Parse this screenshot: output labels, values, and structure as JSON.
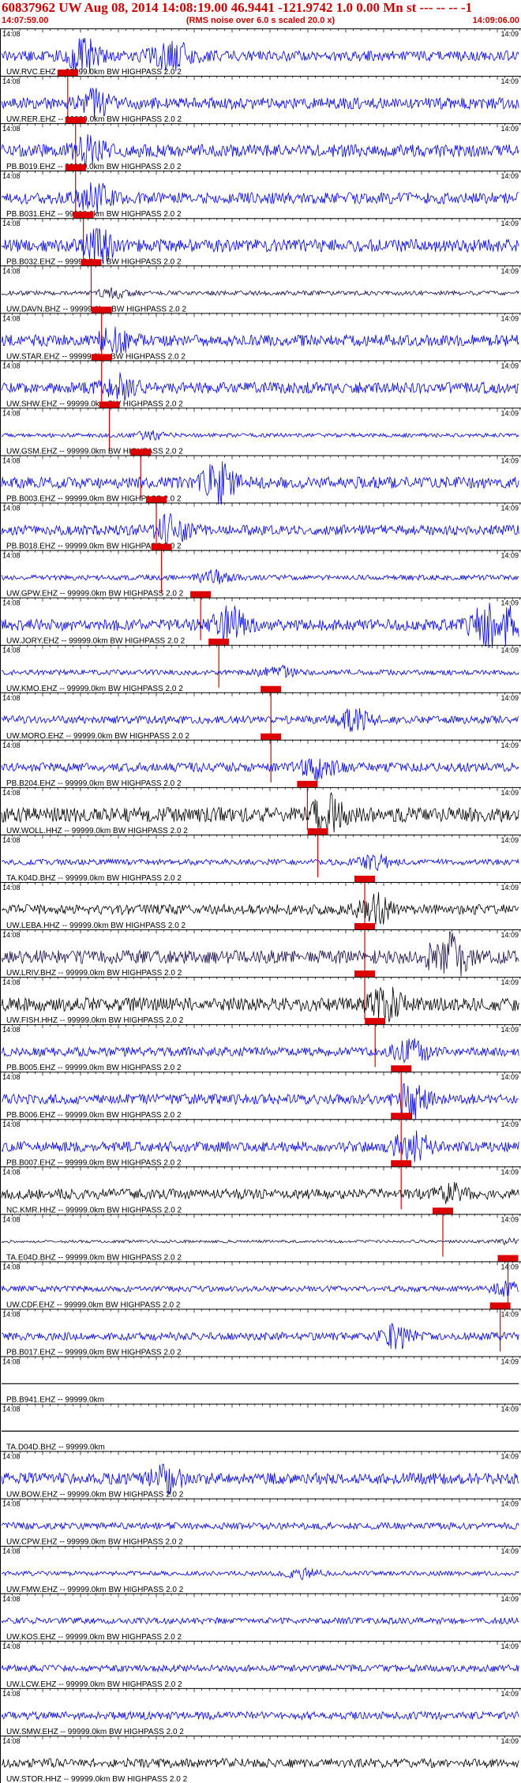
{
  "header": {
    "title": "60837962 UW Aug 08, 2014 14:08:19.00   46.9441 -121.9742  1.0 0.00 Mn st --- -- --  -1",
    "start_time": "14:07:59.00",
    "rms_note": "(RMS noise over 6.0 s scaled 20.0 x)",
    "end_time": "14:09:06.00"
  },
  "colors": {
    "trace_blue": "#0000ee",
    "trace_black": "#000000",
    "trace_navy": "#1a0a4a",
    "pick_red": "#dd0000",
    "label_red": "#cc0000"
  },
  "chart_data": {
    "type": "line",
    "title": "60837962 UW Aug 08, 2014 14:08:19.00",
    "x_start_label": "14:08",
    "x_end_label": "14:09",
    "x_range_seconds": [
      0,
      67
    ],
    "traces": [
      {
        "label": "UW.RVC.EHZ -- 99999.0km BW  HIGHPASS  2.0  2",
        "color": "blue",
        "amp": 0.9,
        "pick": 0.13,
        "burst": 0.16,
        "burst_amp": 2.0,
        "burst2": 0.33,
        "burst2_amp": 1.6
      },
      {
        "label": "UW.RER.EHZ -- 99999.0km BW  HIGHPASS  2.0  2",
        "color": "blue",
        "amp": 1.0,
        "pick": 0.145,
        "burst": 0.18,
        "burst_amp": 1.3
      },
      {
        "label": "PB.B019.EHZ -- 99999.0km BW  HIGHPASS  2.0  2",
        "color": "blue",
        "amp": 1.1,
        "pick": 0.145,
        "burst": 0.17,
        "burst_amp": 1.2
      },
      {
        "label": "PB.B031.EHZ -- 99999.0km BW  HIGHPASS  2.0  2",
        "color": "blue",
        "amp": 1.0,
        "pick": 0.16,
        "burst": 0.18,
        "burst_amp": 1.6
      },
      {
        "label": "PB.B032.EHZ -- 99999.0km BW  HIGHPASS  2.0  2",
        "color": "blue",
        "amp": 1.1,
        "pick": 0.175,
        "burst": 0.19,
        "burst_amp": 1.4
      },
      {
        "label": "UW.DAVN.BHZ -- 99999.0km BW  HIGHPASS  2.0  2",
        "color": "navy",
        "amp": 0.4,
        "pick": 0.195,
        "burst": 0.22,
        "burst_amp": 1.3
      },
      {
        "label": "UW.STAR.EHZ -- 99999.0km BW  HIGHPASS  2.0  2",
        "color": "blue",
        "amp": 1.0,
        "pick": 0.195,
        "burst": 0.22,
        "burst_amp": 1.4
      },
      {
        "label": "UW.SHW.EHZ -- 99999.0km BW  HIGHPASS  2.0  2",
        "color": "blue",
        "amp": 1.0,
        "pick": 0.21,
        "burst": 0.23,
        "burst_amp": 1.2
      },
      {
        "label": "UW.GSM.EHZ -- 99999.0km BW  HIGHPASS  2.0  2",
        "color": "blue",
        "amp": 0.35,
        "pick": 0.27,
        "burst": 0.29,
        "burst_amp": 1.2
      },
      {
        "label": "PB.B003.EHZ -- 99999.0km BW  HIGHPASS  2.0  2",
        "color": "blue",
        "amp": 1.0,
        "pick": 0.3,
        "burst": 0.42,
        "burst_amp": 2.1
      },
      {
        "label": "PB.B018.EHZ -- 99999.0km BW  HIGHPASS  2.0  2",
        "color": "blue",
        "amp": 0.9,
        "pick": 0.31,
        "burst": 0.33,
        "burst_amp": 2.0
      },
      {
        "label": "UW.GPW.EHZ -- 99999.0km BW  HIGHPASS  2.0  2",
        "color": "blue",
        "amp": 0.45,
        "pick": 0.385,
        "burst": 0.41,
        "burst_amp": 1.7
      },
      {
        "label": "UW.JORY.EHZ -- 99999.0km BW  HIGHPASS  2.0  2",
        "color": "blue",
        "amp": 1.0,
        "pick": 0.42,
        "burst": 0.44,
        "burst_amp": 1.8,
        "burst2": 0.95,
        "burst2_amp": 3.0
      },
      {
        "label": "UW.KMO.EHZ -- 99999.0km BW  HIGHPASS  2.0  2",
        "color": "blue",
        "amp": 0.45,
        "pick": 0.52,
        "burst": 0.53,
        "burst_amp": 1.5
      },
      {
        "label": "UW.MORO.EHZ -- 99999.0km BW  HIGHPASS  2.0  2",
        "color": "blue",
        "amp": 0.7,
        "pick": 0.52,
        "burst": 0.68,
        "burst_amp": 1.6
      },
      {
        "label": "PB.B204.EHZ -- 99999.0km BW  HIGHPASS  2.0  2",
        "color": "blue",
        "amp": 0.8,
        "pick": 0.59,
        "burst": 0.61,
        "burst_amp": 1.6
      },
      {
        "label": "UW.WOLL.HHZ -- 99999.0km BW  HIGHPASS  2.0  2",
        "color": "black",
        "amp": 1.3,
        "pick": 0.61,
        "burst": 0.63,
        "burst_amp": 1.5
      },
      {
        "label": "TA.K04D.BHZ -- 99999.0km BW  HIGHPASS  2.0  2",
        "color": "blue",
        "amp": 0.5,
        "pick": 0.7,
        "burst": 0.72,
        "burst_amp": 1.5
      },
      {
        "label": "UW.LEBA.HHZ -- 99999.0km BW  HIGHPASS  2.0  2",
        "color": "black",
        "amp": 0.9,
        "pick": 0.7,
        "burst": 0.72,
        "burst_amp": 1.8
      },
      {
        "label": "UW.LRIV.BHZ -- 99999.0km BW  HIGHPASS  2.0  2",
        "color": "navy",
        "amp": 1.2,
        "pick": 0.7,
        "burst": 0.86,
        "burst_amp": 3.2
      },
      {
        "label": "UW.FISH.HHZ -- 99999.0km BW  HIGHPASS  2.0  2",
        "color": "black",
        "amp": 1.2,
        "pick": 0.72,
        "burst": 0.74,
        "burst_amp": 1.4
      },
      {
        "label": "PB.B005.EHZ -- 99999.0km BW  HIGHPASS  2.0  2",
        "color": "blue",
        "amp": 0.8,
        "pick": 0.77,
        "burst": 0.79,
        "burst_amp": 1.8
      },
      {
        "label": "PB.B006.EHZ -- 99999.0km BW  HIGHPASS  2.0  2",
        "color": "blue",
        "amp": 0.9,
        "pick": 0.77,
        "burst": 0.79,
        "burst_amp": 2.2
      },
      {
        "label": "PB.B007.EHZ -- 99999.0km BW  HIGHPASS  2.0  2",
        "color": "blue",
        "amp": 0.9,
        "pick": 0.77,
        "burst": 0.79,
        "burst_amp": 2.4
      },
      {
        "label": "NC.KMR.HHZ -- 99999.0km BW  HIGHPASS  2.0  2",
        "color": "black",
        "amp": 0.9,
        "pick": 0.85,
        "burst": 0.87,
        "burst_amp": 1.1
      },
      {
        "label": "TA.E04D.BHZ -- 99999.0km BW  HIGHPASS  2.0  2",
        "color": "navy",
        "amp": 0.25,
        "pick": 0.975,
        "burst": 0.98,
        "burst_amp": 1.0
      },
      {
        "label": "UW.CDF.EHZ -- 99999.0km BW  HIGHPASS  2.0  2",
        "color": "blue",
        "amp": 0.5,
        "pick": 0.96,
        "burst": 0.975,
        "burst_amp": 1.4
      },
      {
        "label": "PB.B017.EHZ -- 99999.0km BW  HIGHPASS  2.0  2",
        "color": "blue",
        "amp": 0.7,
        "pick": null,
        "burst": 0.76,
        "burst_amp": 1.7
      },
      {
        "label": "PB.B941.EHZ -- 99999.0km",
        "color": "flat",
        "amp": 0.0,
        "pick": null
      },
      {
        "label": "TA.D04D.BHZ -- 99999.0km",
        "color": "flat",
        "amp": 0.0,
        "pick": null
      },
      {
        "label": "UW.BOW.EHZ -- 99999.0km BW  HIGHPASS  2.0  2",
        "color": "blue",
        "amp": 1.0,
        "pick": null,
        "burst": 0.32,
        "burst_amp": 1.3
      },
      {
        "label": "UW.CPW.EHZ -- 99999.0km BW  HIGHPASS  2.0  2",
        "color": "blue",
        "amp": 0.6,
        "pick": null
      },
      {
        "label": "UW.FMW.EHZ -- 99999.0km BW  HIGHPASS  2.0  2",
        "color": "blue",
        "amp": 0.4,
        "pick": null,
        "burst": 0.58,
        "burst_amp": 1.3
      },
      {
        "label": "UW.KOS.EHZ -- 99999.0km BW  HIGHPASS  2.0  2",
        "color": "blue",
        "amp": 0.55,
        "pick": null
      },
      {
        "label": "UW.LCW.EHZ -- 99999.0km BW  HIGHPASS  2.0  2",
        "color": "blue",
        "amp": 0.6,
        "pick": null
      },
      {
        "label": "UW.SMW.EHZ -- 99999.0km BW  HIGHPASS  2.0  2",
        "color": "blue",
        "amp": 0.7,
        "pick": null
      },
      {
        "label": "UW.STOR.HHZ -- 99999.0km BW  HIGHPASS  2.0  2",
        "color": "black",
        "amp": 0.8,
        "pick": null
      }
    ]
  }
}
